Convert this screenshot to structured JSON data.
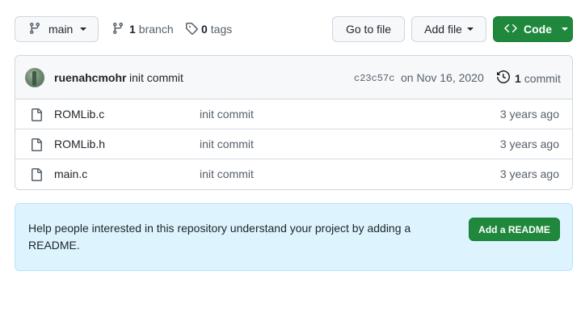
{
  "toolbar": {
    "branch_name": "main",
    "branch_count": "1",
    "branch_label": "branch",
    "tag_count": "0",
    "tag_label": "tags",
    "go_to_file": "Go to file",
    "add_file": "Add file",
    "code": "Code"
  },
  "latest_commit": {
    "author": "ruenahcmohr",
    "message": "init commit",
    "sha": "c23c57c",
    "date": "on Nov 16, 2020",
    "commit_count": "1",
    "commit_label": "commit"
  },
  "files": [
    {
      "name": "ROMLib.c",
      "message": "init commit",
      "age": "3 years ago",
      "icon": "file-icon"
    },
    {
      "name": "ROMLib.h",
      "message": "init commit",
      "age": "3 years ago",
      "icon": "file-icon"
    },
    {
      "name": "main.c",
      "message": "init commit",
      "age": "3 years ago",
      "icon": "file-icon"
    }
  ],
  "readme_prompt": {
    "text": "Help people interested in this repository understand your project by adding a README.",
    "button": "Add a README"
  },
  "colors": {
    "accent_green": "#1f883d",
    "readme_bg": "#ddf4ff"
  }
}
